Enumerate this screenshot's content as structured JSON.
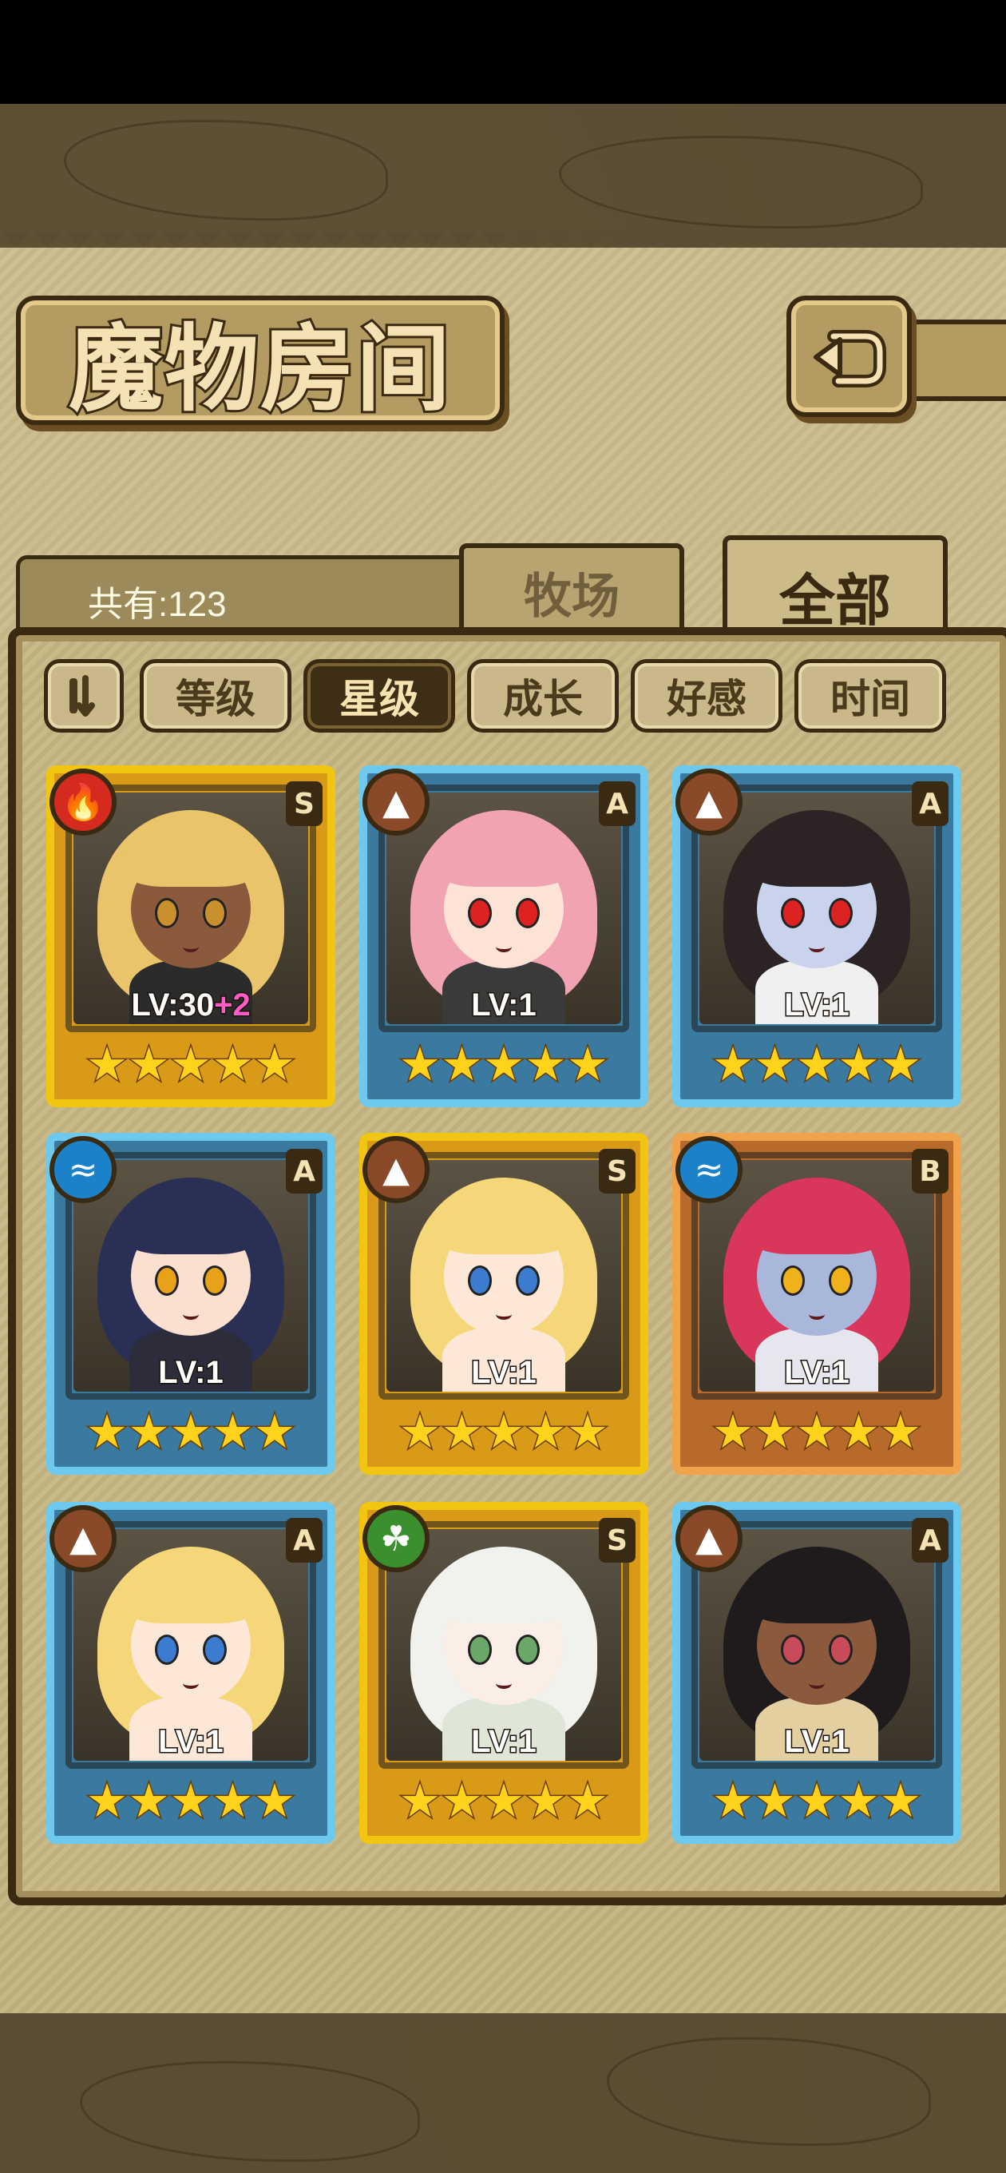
{
  "title": "魔物房间",
  "count_label": "共有:123",
  "tabs": [
    {
      "label": "牧场",
      "active": false
    },
    {
      "label": "全部",
      "active": true
    }
  ],
  "sort_buttons": [
    {
      "label": "等级",
      "active": false
    },
    {
      "label": "星级",
      "active": true
    },
    {
      "label": "成长",
      "active": false
    },
    {
      "label": "好感",
      "active": false
    },
    {
      "label": "时间",
      "active": false
    }
  ],
  "cards": [
    {
      "frame": "gold",
      "element": "fire-icon",
      "grade": "S",
      "level": "LV:30",
      "bonus": "+2",
      "stars": 5,
      "hair": "#e9c46a",
      "skin": "#8b5a3c",
      "eyes": "#c9902e",
      "body": "#2b2b2b"
    },
    {
      "frame": "blue",
      "element": "earth-icon",
      "grade": "A",
      "level": "LV:1",
      "bonus": "",
      "stars": 5,
      "hair": "#f2a3b2",
      "skin": "#fde3d6",
      "eyes": "#d22",
      "body": "#3a3a3a"
    },
    {
      "frame": "blue",
      "element": "earth-icon",
      "grade": "A",
      "level": "LV:1",
      "bonus": "",
      "stars": 5,
      "hair": "#2b2324",
      "skin": "#c9d3ee",
      "eyes": "#d22",
      "body": "#f0f0f0"
    },
    {
      "frame": "blue",
      "element": "water-icon",
      "grade": "A",
      "level": "LV:1",
      "bonus": "",
      "stars": 5,
      "hair": "#2a2f55",
      "skin": "#fbe0cf",
      "eyes": "#e8a21a",
      "body": "#2c2c3a"
    },
    {
      "frame": "gold",
      "element": "earth-icon",
      "grade": "S",
      "level": "LV:1",
      "bonus": "",
      "stars": 5,
      "hair": "#f5d77a",
      "skin": "#fde7d6",
      "eyes": "#3b7bd0",
      "body": "#fde7d6"
    },
    {
      "frame": "bronze",
      "element": "water-icon",
      "grade": "B",
      "level": "LV:1",
      "bonus": "",
      "stars": 5,
      "hair": "#d9365c",
      "skin": "#a9b8da",
      "eyes": "#f0b21a",
      "body": "#e6e6ee"
    },
    {
      "frame": "blue",
      "element": "earth-icon",
      "grade": "A",
      "level": "LV:1",
      "bonus": "",
      "stars": 5,
      "hair": "#f5d77a",
      "skin": "#fde7d6",
      "eyes": "#3b7bd0",
      "body": "#fde7d6"
    },
    {
      "frame": "gold",
      "element": "wind-icon",
      "grade": "S",
      "level": "LV:1",
      "bonus": "",
      "stars": 5,
      "hair": "#f1f1ee",
      "skin": "#fbeee6",
      "eyes": "#6aa86a",
      "body": "#dfe6d8"
    },
    {
      "frame": "blue",
      "element": "earth-icon",
      "grade": "A",
      "level": "LV:1",
      "bonus": "",
      "stars": 5,
      "hair": "#1f1a1c",
      "skin": "#8b5a3c",
      "eyes": "#c84b5a",
      "body": "#e3cfa0"
    }
  ]
}
